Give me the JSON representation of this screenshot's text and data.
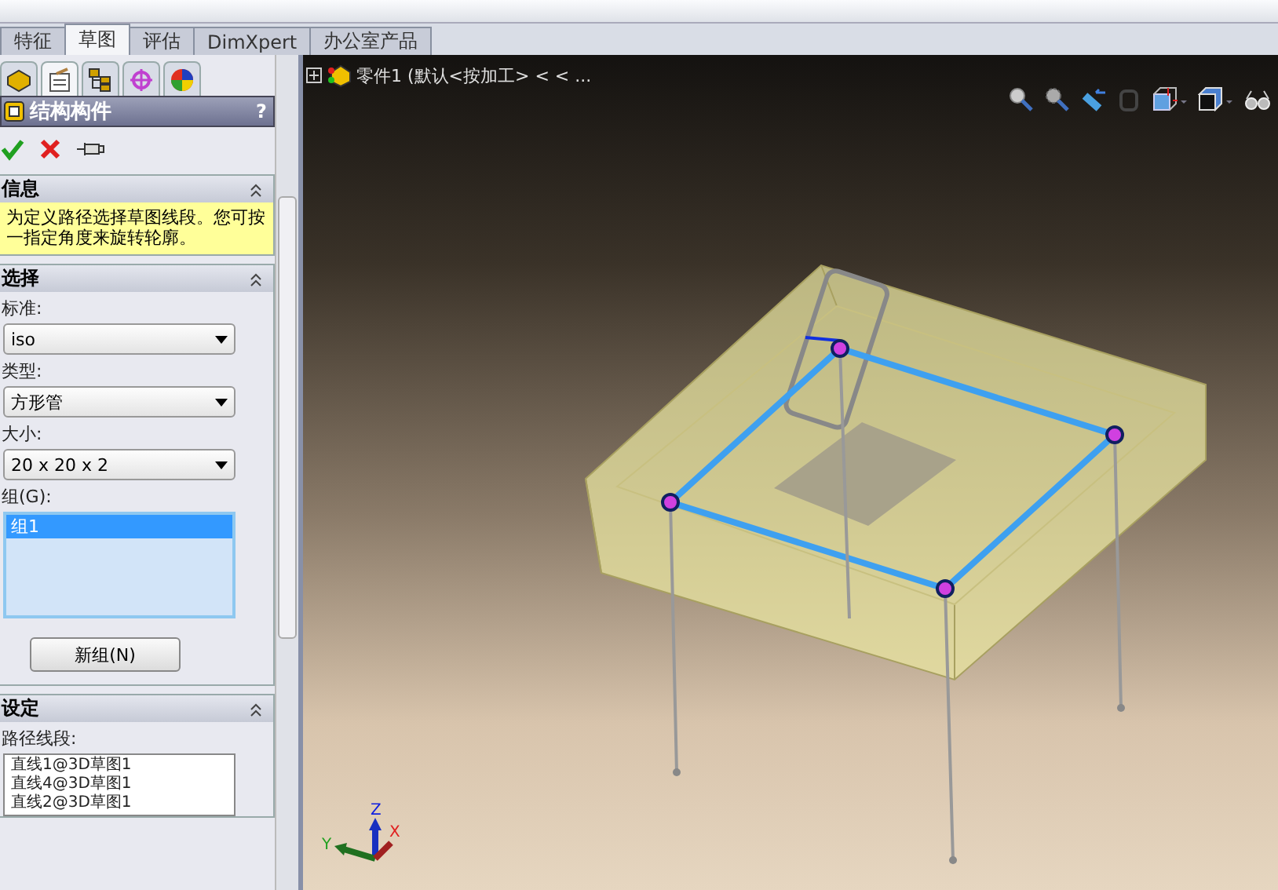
{
  "tabs": [
    {
      "label": "特征",
      "selected": false
    },
    {
      "label": "草图",
      "selected": true
    },
    {
      "label": "评估",
      "selected": false
    },
    {
      "label": "DimXpert",
      "selected": false
    },
    {
      "label": "办公室产品",
      "selected": false
    }
  ],
  "panel": {
    "icon_tabs": [
      {
        "kind": "part",
        "selected": false
      },
      {
        "kind": "property",
        "selected": true
      },
      {
        "kind": "config",
        "selected": false
      },
      {
        "kind": "target",
        "selected": false
      },
      {
        "kind": "appearance",
        "selected": false
      }
    ],
    "title": "结构构件",
    "help": "?",
    "sections": [
      {
        "title": "信息",
        "message": "为定义路径选择草图线段。您可按一指定角度来旋转轮廓。"
      },
      {
        "title": "选择",
        "fields": [
          {
            "label": "标准:",
            "value": "iso"
          },
          {
            "label": "类型:",
            "value": "方形管"
          },
          {
            "label": "大小:",
            "value": "20 x 20 x 2"
          }
        ],
        "group_label": "组(G):",
        "groups": [
          {
            "label": "组1",
            "selected": true
          }
        ],
        "new_group_button": "新组(N)"
      },
      {
        "title": "设定",
        "path_label": "路径线段:",
        "path_items": [
          "直线1@3D草图1",
          "直线4@3D草图1",
          "直线2@3D草图1"
        ]
      }
    ]
  },
  "viewport": {
    "tree_item": "零件1 (默认<按加工> < < ...",
    "axes": [
      "X",
      "Y",
      "Z"
    ]
  }
}
